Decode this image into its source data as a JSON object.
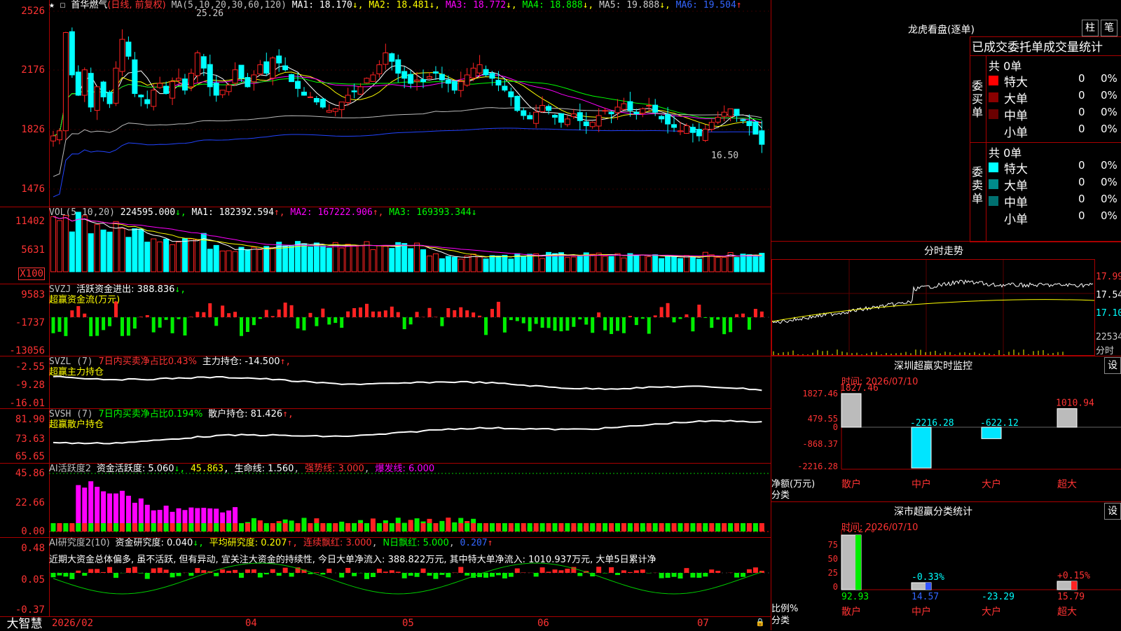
{
  "stock": {
    "name": "首华燃气",
    "mode": "(日线, 前复权)"
  },
  "price_axis": [
    "2526",
    "2176",
    "1826",
    "1476"
  ],
  "price_annot": {
    "high": "25.26",
    "low": "16.50"
  },
  "ma_line": {
    "label": "MA(5,10,20,30,60,120)",
    "ma1": "MA1: 18.170",
    "ma2": "MA2: 18.481",
    "ma3": "MA3: 18.772",
    "ma4": "MA4: 18.888",
    "ma5": "MA5: 19.888",
    "ma6": "MA6: 19.504"
  },
  "vol": {
    "label": "VOL(5,10,20)",
    "value": "224595.000",
    "ma1": "MA1: 182392.594",
    "ma2": "MA2: 167222.906",
    "ma3": "MA3: 169393.344",
    "axis": [
      "11402",
      "5631"
    ],
    "unit": "X100"
  },
  "svzj": {
    "label": "SVZJ",
    "text": "活跃资金进出: 388.836",
    "sub": "超赢资金流(万元)",
    "axis": [
      "9583",
      "-1737",
      "-13056"
    ]
  },
  "svzl": {
    "label": "SVZL (7)",
    "pct": "7日内买卖净占比0.43%",
    "hold": "主力持仓: -14.500",
    "sub": "超赢主力持仓",
    "axis": [
      "-2.55",
      "-9.28",
      "-16.01"
    ]
  },
  "svsh": {
    "label": "SVSH (7)",
    "pct": "7日内买卖净占比0.194%",
    "hold": "散户持仓: 81.426",
    "sub": "超赢散户持仓",
    "axis": [
      "81.90",
      "73.63",
      "65.65"
    ]
  },
  "ai2": {
    "label": "AI活跃度2",
    "act": "资金活跃度: 5.060",
    "v2": "45.863",
    "life": "生命线: 1.560",
    "strong": "强势线: 3.000",
    "burst": "爆发线: 6.000",
    "axis": [
      "45.86",
      "22.66",
      "0.00"
    ]
  },
  "ai_res": {
    "label": "AI研究度2(10)",
    "res": "资金研究度: 0.040",
    "avg": "平均研究度: 0.207",
    "red": "连续飘红: 3.000",
    "nday": "N日飘红: 5.000",
    "v5": "0.207",
    "comment": "近期大资金总体偏多, 虽不活跃, 但有异动, 宜关注大资金的持续性, 今日大单净流入: 388.822万元, 其中特大单净流入: 1010.937万元, 大单5日累计净",
    "axis": [
      "0.48",
      "0.05",
      "-0.37"
    ]
  },
  "dates": [
    "2026/02",
    "04",
    "05",
    "06",
    "07"
  ],
  "brand": "大智慧",
  "lhkp": {
    "title": "龙虎看盘(逐单)",
    "tab1": "柱",
    "tab2": "笔",
    "header": "已成交委托单成交量统计",
    "buy": {
      "side": "委买单",
      "total": "共 0单",
      "rows": [
        {
          "label": "特大",
          "n": "0",
          "p": "0%",
          "color": "#ff0000"
        },
        {
          "label": "大单",
          "n": "0",
          "p": "0%",
          "color": "#8b0000"
        },
        {
          "label": "中单",
          "n": "0",
          "p": "0%",
          "color": "#6b0000"
        },
        {
          "label": "小单",
          "n": "0",
          "p": "0%",
          "color": ""
        }
      ]
    },
    "sell": {
      "side": "委卖单",
      "total": "共 0单",
      "rows": [
        {
          "label": "特大",
          "n": "0",
          "p": "0%",
          "color": "#00ffff"
        },
        {
          "label": "大单",
          "n": "0",
          "p": "0%",
          "color": "#008b8b"
        },
        {
          "label": "中单",
          "n": "0",
          "p": "0%",
          "color": "#007070"
        },
        {
          "label": "小单",
          "n": "0",
          "p": "0%",
          "color": ""
        }
      ]
    }
  },
  "intraday": {
    "title": "分时走势",
    "axis": [
      "17.99",
      "17.54",
      "17.10"
    ],
    "vol_label": "22534",
    "unit": "分时"
  },
  "sz_monitor": {
    "title": "深圳超赢实时监控",
    "btn": "设",
    "time": "时间: 2026/07/10",
    "axis": [
      "1827.46",
      "479.55",
      "0",
      "-868.37",
      "-2216.28"
    ],
    "ylabel": "净额(万元)",
    "xlabel": "分类",
    "cats": [
      "散户",
      "中户",
      "大户",
      "超大"
    ],
    "values": [
      "1827.46",
      "-2216.28",
      "-622.12",
      "1010.94"
    ]
  },
  "sz_class": {
    "title": "深市超赢分类统计",
    "btn": "设",
    "time": "时间: 2026/07/10",
    "axis": [
      "75",
      "50",
      "25",
      "0"
    ],
    "ylabel": "比例%",
    "xlabel": "分类",
    "cats": [
      "散户",
      "中户",
      "大户",
      "超大"
    ],
    "top": [
      "+0.27%",
      "-0.33%",
      "",
      "+0.15%"
    ],
    "bottom": [
      "92.93",
      "14.57",
      "-23.29",
      "15.79"
    ]
  },
  "colors": {
    "up": "#ff2222",
    "down": "#00ffff",
    "green": "#00ff00",
    "magenta": "#ff00ff",
    "yellow": "#ffff00",
    "grid": "#aa0000"
  }
}
